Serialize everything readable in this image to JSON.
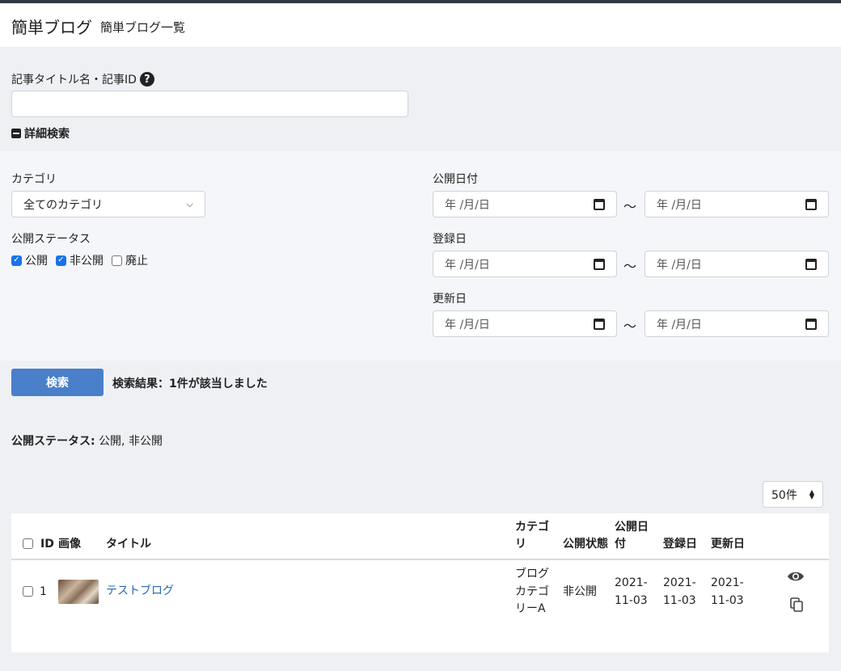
{
  "header": {
    "title": "簡単ブログ",
    "subtitle": "簡単ブログ一覧"
  },
  "search": {
    "keyword_label": "記事タイトル名・記事ID",
    "keyword_value": "",
    "help_icon": "question-circle-icon",
    "advanced_toggle": "詳細検索",
    "category_label": "カテゴリ",
    "category_selected": "全てのカテゴリ",
    "status_label": "公開ステータス",
    "status_options": [
      {
        "label": "公開",
        "checked": true
      },
      {
        "label": "非公開",
        "checked": true
      },
      {
        "label": "廃止",
        "checked": false
      }
    ],
    "date_placeholder": "年 /月/日",
    "tilde": "〜",
    "publish_date_label": "公開日付",
    "register_date_label": "登録日",
    "update_date_label": "更新日",
    "search_button": "検索",
    "result_text": "検索結果：1件が該当しました"
  },
  "filter_summary": {
    "label": "公開ステータス:",
    "value": "公開, 非公開"
  },
  "per_page": "50件",
  "table": {
    "headers": {
      "id": "ID",
      "image": "画像",
      "title": "タイトル",
      "category_line1": "カテゴ",
      "category_line2": "リ",
      "status": "公開状態",
      "publish_line1": "公開日",
      "publish_line2": "付",
      "registered": "登録日",
      "updated": "更新日"
    },
    "rows": [
      {
        "id": "1",
        "title": "テストブログ",
        "category_lines": [
          "ブログ",
          "カテゴ",
          "リーA"
        ],
        "status": "非公開",
        "publish_date_lines": [
          "2021-",
          "11-03"
        ],
        "registered_lines": [
          "2021-",
          "11-03"
        ],
        "updated_lines": [
          "2021-",
          "11-03"
        ]
      }
    ]
  },
  "colors": {
    "accent": "#4a7fc9",
    "link": "#2a68b0",
    "checkbox": "#1a73e8",
    "topbar": "#2f3740"
  }
}
